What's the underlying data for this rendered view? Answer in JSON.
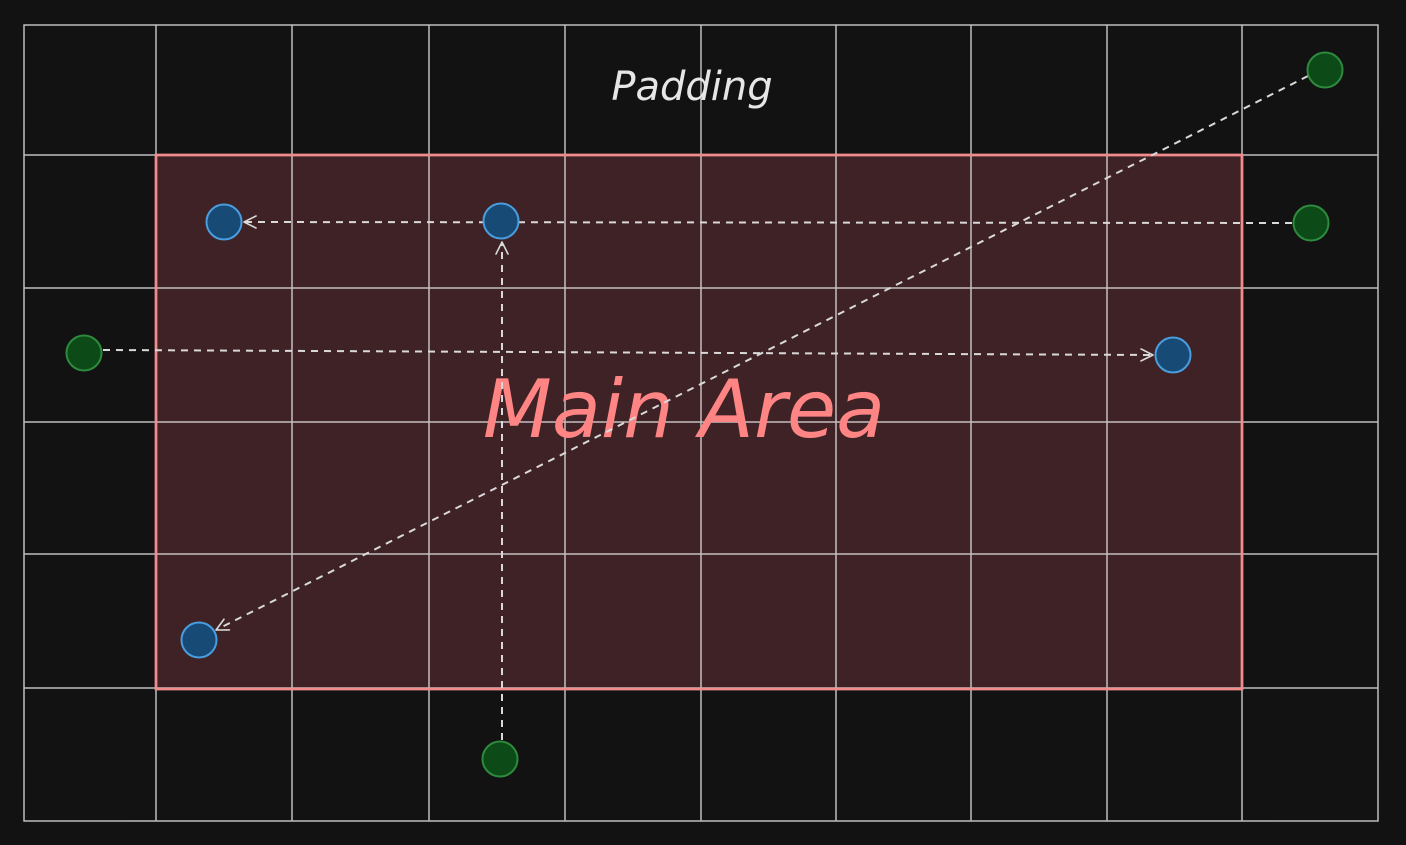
{
  "labels": {
    "padding": "Padding",
    "main_area": "Main Area"
  },
  "colors": {
    "background": "#121212",
    "grid_line": "#dcdcdc",
    "main_area_fill": "#3e2225",
    "main_area_border": "#f28b8b",
    "main_area_text": "#ff8585",
    "arrow": "#d9d9d9",
    "source_point_fill": "#0c4a17",
    "source_point_stroke": "#2e8a3c",
    "target_point_fill": "#174a75",
    "target_point_stroke": "#4a9ee0"
  },
  "legend": {
    "source_points": "green circles (points in padding)",
    "target_points": "blue circles (points moved into main area)"
  }
}
